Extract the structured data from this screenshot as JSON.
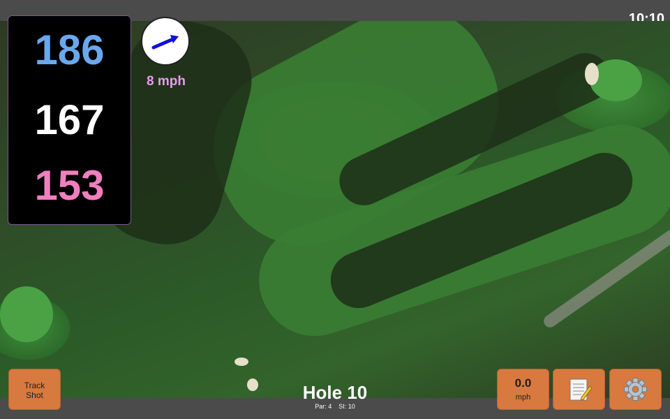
{
  "status": {
    "time": "10:10"
  },
  "distances": {
    "back": "186",
    "middle": "167",
    "front": "153"
  },
  "wind": {
    "speed_label": "8 mph",
    "direction_icon": "arrow-icon"
  },
  "buttons": {
    "track_shot": "Track\nShot",
    "speed_value": "0.0",
    "speed_unit": "mph",
    "notes_icon": "notepad-icon",
    "settings_icon": "gear-icon"
  },
  "hole": {
    "title": "Hole 10",
    "par_label": "Par: 4",
    "si_label": "SI: 10"
  },
  "colors": {
    "accent": "#d8793f",
    "back": "#6aa8ee",
    "front": "#f07fbe",
    "wind": "#e99bf0"
  }
}
